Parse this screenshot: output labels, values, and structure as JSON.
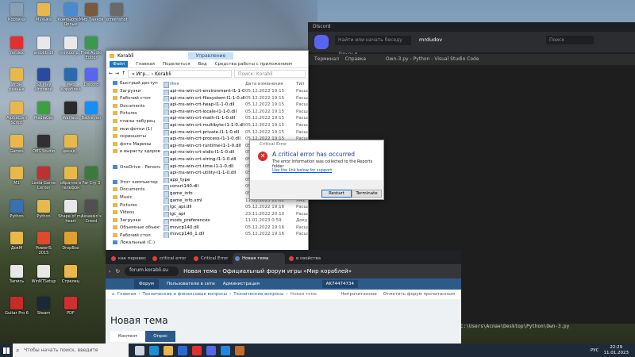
{
  "desktop_icons": [
    {
      "label": "Корзина",
      "color": "#8aa0b4"
    },
    {
      "label": "Музыка",
      "color": "#e8b84a"
    },
    {
      "label": "Компьютер - Ярлык",
      "color": "#4a8ad0"
    },
    {
      "label": "Мир Танков",
      "color": "#7a5a3a"
    },
    {
      "label": "screenshot",
      "color": "#6a6a6a"
    },
    {
      "label": "Yandex",
      "color": "#e03030"
    },
    {
      "label": "amblib.dll",
      "color": "#e8e8e8"
    },
    {
      "label": "minkoo_p...",
      "color": "#e8e8e8"
    },
    {
      "label": "Free Audio Editor",
      "color": "#3a9a4a"
    },
    {
      "label": "Игры разные",
      "color": "#e8b84a"
    },
    {
      "label": "SX Play Игровой",
      "color": "#2a4aa0"
    },
    {
      "label": "Мир Кораблей",
      "color": "#2a6ab0"
    },
    {
      "label": "Discord",
      "color": "#5865f2"
    },
    {
      "label": "AlphaCom Script",
      "color": "#e8b84a"
    },
    {
      "label": "MediaGet",
      "color": "#3aa040"
    },
    {
      "label": "Warface",
      "color": "#2a2a2a"
    },
    {
      "label": "Battle.net",
      "color": "#148eff"
    },
    {
      "label": "Games",
      "color": "#e8b84a"
    },
    {
      "label": "OBS Studio",
      "color": "#303030"
    },
    {
      "label": "декад...",
      "color": "#e8b84a"
    },
    {
      "label": "Python",
      "color": "#3a70b0"
    },
    {
      "label": "M1",
      "color": "#e8b84a"
    },
    {
      "label": "Lesta Game Center",
      "color": "#c03030"
    },
    {
      "label": "обратно в телефон",
      "color": "#e8b84a"
    },
    {
      "label": "Far Cry 3",
      "color": "#3a7a3a"
    },
    {
      "label": "Python",
      "color": "#e8b84a"
    },
    {
      "label": "Shape of my heart",
      "color": "#e8e8e8"
    },
    {
      "label": "Assassin's Creed",
      "color": "#505050"
    },
    {
      "label": "ДокМ",
      "color": "#e8b84a"
    },
    {
      "label": "PowerIS 2015",
      "color": "#e04a2a"
    },
    {
      "label": "DropBox",
      "color": "#e0a030"
    },
    {
      "label": "Запись",
      "color": "#e8e8e8"
    },
    {
      "label": "WinNTSetup",
      "color": "#e8e8e8"
    },
    {
      "label": "Стрелец",
      "color": "#e8b84a"
    },
    {
      "label": "Guitar Pro 6",
      "color": "#c82a2a"
    },
    {
      "label": "Steam",
      "color": "#1b2838"
    },
    {
      "label": "PDF",
      "color": "#d03030"
    }
  ],
  "discord": {
    "title": "Discord",
    "search_placeholder": "Найти или начать беседу",
    "username": "mrdudov",
    "search_box": "Поиск",
    "friends_label": "Друзья"
  },
  "vscode": {
    "menu_terminal": "Терминал",
    "menu_help": "Справка",
    "title": "Own-3.py - Python - Visual Studio Code",
    "terminal_line": "C:\\Users\\Аслан\\Desktop\\Python\\Own-3.py"
  },
  "explorer": {
    "title": "Korabli",
    "management_tab": "Управление",
    "ribbon": {
      "file": "Файл",
      "home": "Главная",
      "share": "Поделиться",
      "view": "Вид",
      "tools": "Средства работы с приложением"
    },
    "path": "« Игр... › Korabli",
    "search_placeholder": "Поиск: Korabli",
    "nav": [
      {
        "label": "Быстрый доступ",
        "pc": true
      },
      {
        "label": "Загрузки",
        "pc": false
      },
      {
        "label": "Рабочий стол",
        "pc": false
      },
      {
        "label": "Documents",
        "pc": false
      },
      {
        "label": "Pictures",
        "pc": false
      },
      {
        "label": "планы чебурец",
        "pc": false
      },
      {
        "label": "мои фотки (1)",
        "pc": false
      },
      {
        "label": "скриншоты",
        "pc": false
      },
      {
        "label": "фото Марины",
        "pc": false
      },
      {
        "label": "в вырасту здоровы",
        "pc": false
      },
      {
        "label": "",
        "pc": false
      },
      {
        "label": "OneDrive - Personal",
        "pc": true
      },
      {
        "label": "",
        "pc": false
      },
      {
        "label": "Этот компьютер",
        "pc": true
      },
      {
        "label": "Documents",
        "pc": false
      },
      {
        "label": "Music",
        "pc": false
      },
      {
        "label": "Pictures",
        "pc": false
      },
      {
        "label": "Videos",
        "pc": false
      },
      {
        "label": "Загрузки",
        "pc": false
      },
      {
        "label": "Объемные объект",
        "pc": false
      },
      {
        "label": "Рабочий стол",
        "pc": false
      },
      {
        "label": "Локальный (C:)",
        "pc": true
      }
    ],
    "columns": {
      "name": "Имя",
      "date": "Дата изменения",
      "type": "Тип"
    },
    "files": [
      {
        "name": "api-ms-win-crt-environment-l1-1-0.dll",
        "date": "05.12.2022 19:15",
        "type": "Расш"
      },
      {
        "name": "api-ms-win-crt-filesystem-l1-1-0.dll",
        "date": "05.12.2022 19:15",
        "type": "Расш"
      },
      {
        "name": "api-ms-win-crt-heap-l1-1-0.dll",
        "date": "05.12.2022 19:15",
        "type": "Расш"
      },
      {
        "name": "api-ms-win-crt-locale-l1-1-0.dll",
        "date": "05.12.2022 19:15",
        "type": "Расш"
      },
      {
        "name": "api-ms-win-crt-math-l1-1-0.dll",
        "date": "05.12.2022 19:15",
        "type": "Расш"
      },
      {
        "name": "api-ms-win-crt-multibyte-l1-1-0.dll",
        "date": "05.12.2022 19:15",
        "type": "Расш"
      },
      {
        "name": "api-ms-win-crt-private-l1-1-0.dll",
        "date": "05.12.2022 19:15",
        "type": "Расш"
      },
      {
        "name": "api-ms-win-crt-process-l1-1-0.dll",
        "date": "05.12.2022 19:15",
        "type": "Расш"
      },
      {
        "name": "api-ms-win-crt-runtime-l1-1-0.dll",
        "date": "05.12.2022 19:15",
        "type": "Расш"
      },
      {
        "name": "api-ms-win-crt-stdio-l1-1-0.dll",
        "date": "05.12.2022 19:15",
        "type": "Расш"
      },
      {
        "name": "api-ms-win-crt-string-l1-1-0.dll",
        "date": "05.12.2022 19:15",
        "type": "Расш"
      },
      {
        "name": "api-ms-win-crt-time-l1-1-0.dll",
        "date": "05.12.2022 19:15",
        "type": "Расш"
      },
      {
        "name": "api-ms-win-crt-utility-l1-1-0.dll",
        "date": "05.12.2022 19:15",
        "type": "Расш"
      },
      {
        "name": "app_type",
        "date": "05.12.2022 19:15",
        "type": "Файл"
      },
      {
        "name": "concrt140.dll",
        "date": "05.12.2022 19:15",
        "type": "Расш"
      },
      {
        "name": "game_info",
        "date": "05.12.2022 19:15",
        "type": "Файл"
      },
      {
        "name": "game_info.xml",
        "date": "11.01.2023 22:02",
        "type": "XML"
      },
      {
        "name": "lgc_api.dll",
        "date": "05.12.2022 19:16",
        "type": "Расш"
      },
      {
        "name": "lgc_api",
        "date": "23.11.2022 20:10",
        "type": "Расш"
      },
      {
        "name": "mods_preferences",
        "date": "11.01.2023 0:59",
        "type": "Доку"
      },
      {
        "name": "msvcp140.dll",
        "date": "05.12.2022 19:16",
        "type": "Расш"
      },
      {
        "name": "msvcp140_1.dll",
        "date": "05.12.2022 19:16",
        "type": "Расш"
      }
    ]
  },
  "error_dialog": {
    "title": "Critical Error",
    "heading": "A critical error has occurred",
    "message": "The error information was collected to the Reports folder",
    "link": "Use the link below for support",
    "restart": "Restart",
    "terminate": "Terminate"
  },
  "browser": {
    "tabs": [
      "как перевес",
      "critical error",
      "Critical Error",
      "Новая тема",
      "в свойства"
    ],
    "active_tab_index": 3,
    "url": "forum.korabli.su",
    "page_title": "Новая тема - Официальный форум игры «Мир кораблей»",
    "site_nav": {
      "forum": "Форум",
      "users": "Пользователи в сети",
      "admin": "Администрация",
      "user": "AK74474734"
    },
    "crumbs": [
      "Главная",
      "Технические и финансовые вопросы",
      "Технические вопросы",
      "Новая тема"
    ],
    "crumbs_right": [
      "Непрочитанное",
      "Отметить форум прочитанным"
    ],
    "heading": "Новая тема",
    "subtabs": [
      "Контент",
      "Опрос"
    ]
  },
  "taskbar": {
    "search_placeholder": "Чтобы начать поиск, введите",
    "apps": [
      {
        "name": "task-view-icon",
        "color": "#cfd6df"
      },
      {
        "name": "edge-icon",
        "color": "#1a8fd6"
      },
      {
        "name": "explorer-icon",
        "color": "#e8b84a"
      },
      {
        "name": "store-icon",
        "color": "#2a6ad0"
      },
      {
        "name": "yandex-icon",
        "color": "#e03030"
      },
      {
        "name": "discord-icon",
        "color": "#5865f2"
      },
      {
        "name": "vscode-icon",
        "color": "#1e88e5"
      },
      {
        "name": "game-icon",
        "color": "#c86a2a"
      }
    ],
    "lang": "РУС",
    "time": "22:29",
    "date": "11.01.2023"
  }
}
